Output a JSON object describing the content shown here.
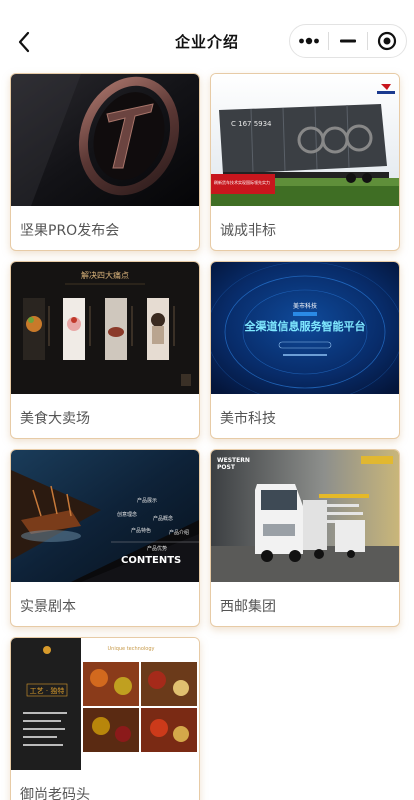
{
  "nav": {
    "title": "企业介绍",
    "back_icon": "chevron-left-icon",
    "menu_icon": "more-dots-icon",
    "minimize_icon": "minimize-icon",
    "close_icon": "target-icon"
  },
  "accent_border": "#e7cba6",
  "cards": [
    {
      "label": "坚果PRO发布会"
    },
    {
      "label": "诚成非标",
      "thumb": {
        "train_number": "C 167 5934",
        "caption": "刷新货车技术实现国际领先实力"
      }
    },
    {
      "label": "美食大卖场",
      "thumb": {
        "headline": "解决四大痛点"
      }
    },
    {
      "label": "美市科技",
      "thumb": {
        "brand": "美市科技",
        "headline": "全渠道信息服务智能平台"
      }
    },
    {
      "label": "实景剧本",
      "thumb": {
        "contents": "CONTENTS",
        "items": [
          "产品展示",
          "创意理念",
          "产品概念",
          "产品特色",
          "产品介绍",
          "产品优势"
        ]
      }
    },
    {
      "label": "西邮集团",
      "thumb": {
        "brand_line1": "WESTERN",
        "brand_line2": "POST"
      }
    },
    {
      "label": "御尚老码头",
      "thumb": {
        "tagline": "Unique technology",
        "headline": "工艺 · 独特"
      }
    }
  ]
}
